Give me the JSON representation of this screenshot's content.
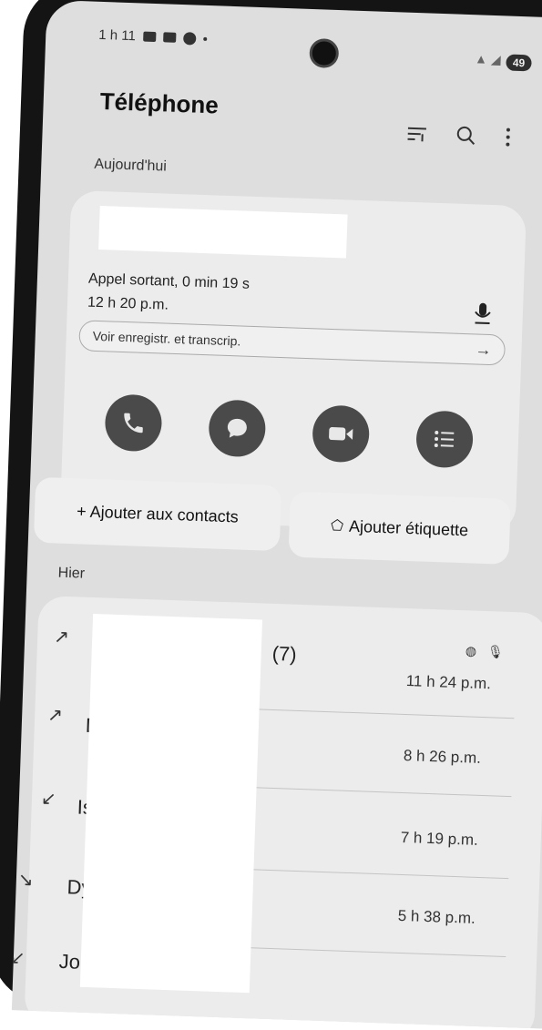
{
  "status_bar": {
    "time": "1 h 11",
    "battery": "49"
  },
  "header": {
    "title": "Téléphone"
  },
  "today": {
    "section_label": "Aujourd'hui",
    "call_info": "Appel sortant, 0 min 19 s",
    "call_time": "12 h 20 p.m.",
    "recording_pill": "Voir enregistr. et transcrip."
  },
  "actions": {
    "add_contact": "+ Ajouter aux contacts",
    "add_tag": "Ajouter étiquette"
  },
  "yesterday": {
    "section_label": "Hier",
    "calls": [
      {
        "visible_name": "",
        "count": "(7)",
        "time": "11 h 24 p.m."
      },
      {
        "visible_name": "D",
        "count": "",
        "time": "8 h 26 p.m."
      },
      {
        "visible_name": "Is",
        "count": "",
        "time": "7 h 19 p.m."
      },
      {
        "visible_name": "Dy",
        "count": "",
        "time": "5 h 38 p.m."
      },
      {
        "visible_name": "Jo",
        "count": "",
        "time": ""
      }
    ]
  },
  "icons": {
    "filter": "filter-icon",
    "search": "search-icon",
    "more": "more-vert-icon",
    "call": "phone-icon",
    "message": "chat-icon",
    "video": "video-icon",
    "details": "list-icon"
  }
}
